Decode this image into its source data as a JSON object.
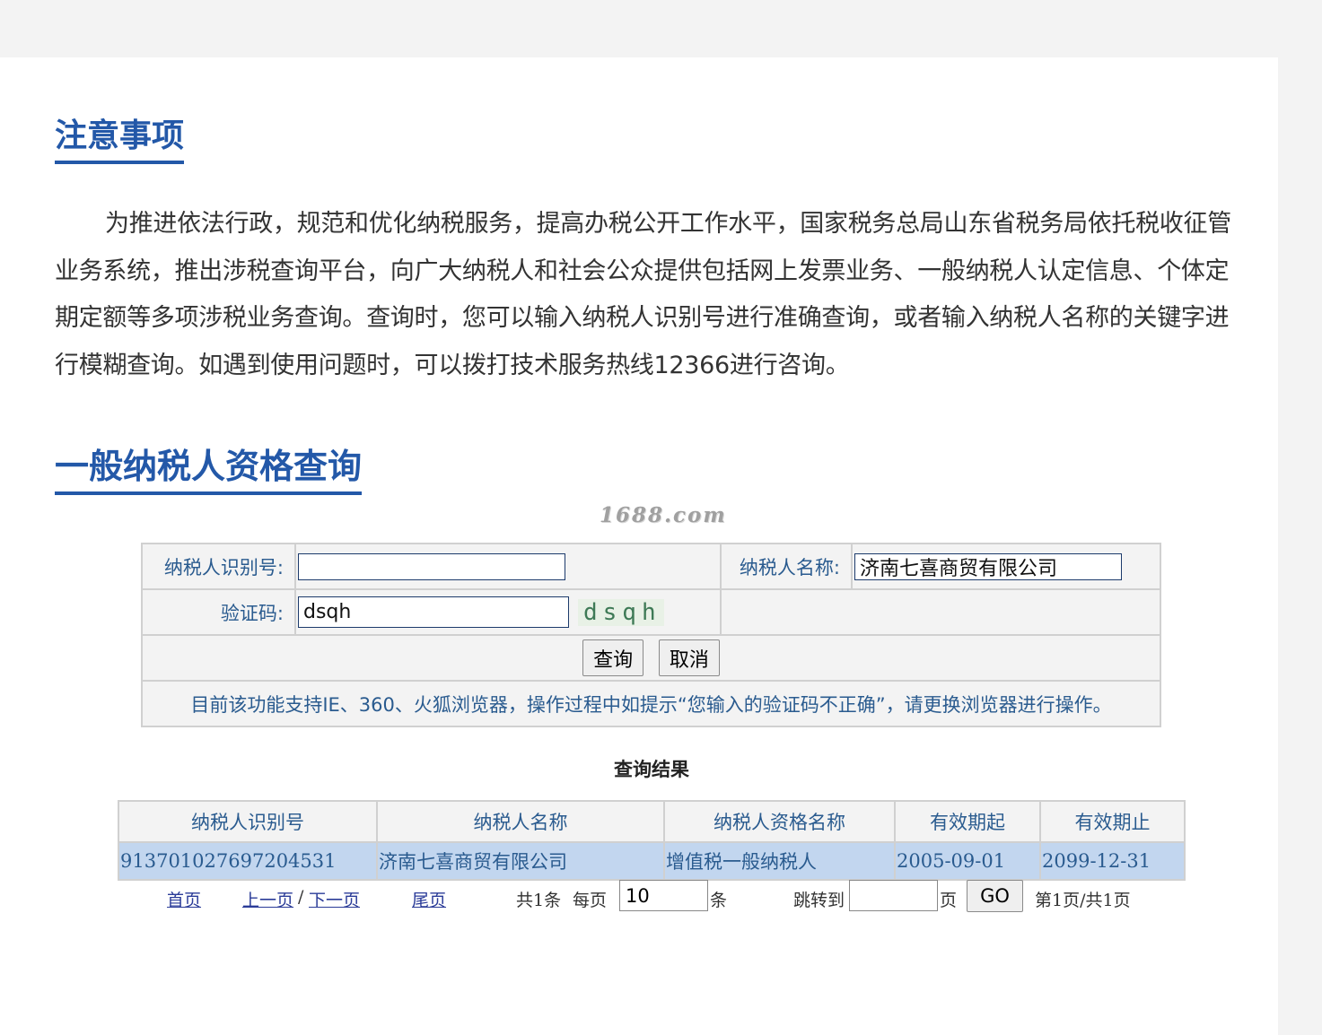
{
  "notice": {
    "title": "注意事项",
    "body": "为推进依法行政，规范和优化纳税服务，提高办税公开工作水平，国家税务总局山东省税务局依托税收征管业务系统，推出涉税查询平台，向广大纳税人和社会公众提供包括网上发票业务、一般纳税人认定信息、个体定期定额等多项涉税业务查询。查询时，您可以输入纳税人识别号进行准确查询，或者输入纳税人名称的关键字进行模糊查询。如遇到使用问题时，可以拨打技术服务热线12366进行咨询。"
  },
  "query": {
    "title": "一般纳税人资格查询",
    "watermark": "1688.com",
    "taxpayer_id_label": "纳税人识别号:",
    "taxpayer_id_value": "",
    "taxpayer_name_label": "纳税人名称:",
    "taxpayer_name_value": "济南七喜商贸有限公司",
    "captcha_label": "验证码:",
    "captcha_value": "dsqh",
    "captcha_image_text": "dsqh",
    "search_button": "查询",
    "cancel_button": "取消",
    "tip": "目前该功能支持IE、360、火狐浏览器，操作过程中如提示“您输入的验证码不正确”，请更换浏览器进行操作。"
  },
  "results": {
    "title": "查询结果",
    "columns": [
      "纳税人识别号",
      "纳税人名称",
      "纳税人资格名称",
      "有效期起",
      "有效期止"
    ],
    "rows": [
      [
        "913701027697204531",
        "济南七喜商贸有限公司",
        "增值税一般纳税人",
        "2005-09-01",
        "2099-12-31"
      ]
    ]
  },
  "pager": {
    "first": "首页",
    "prev": "上一页",
    "separator": "/",
    "next": "下一页",
    "last": "尾页",
    "total_text": "共1条",
    "per_page_label": "每页",
    "per_page_value": "10",
    "per_page_unit": "条",
    "jump_label": "跳转到",
    "jump_value": "",
    "jump_unit": "页",
    "go_button": "GO",
    "page_status": "第1页/共1页"
  },
  "colors": {
    "accent": "#2358a8",
    "row_highlight": "#c2d6ef",
    "label_text": "#2a5b8f"
  }
}
